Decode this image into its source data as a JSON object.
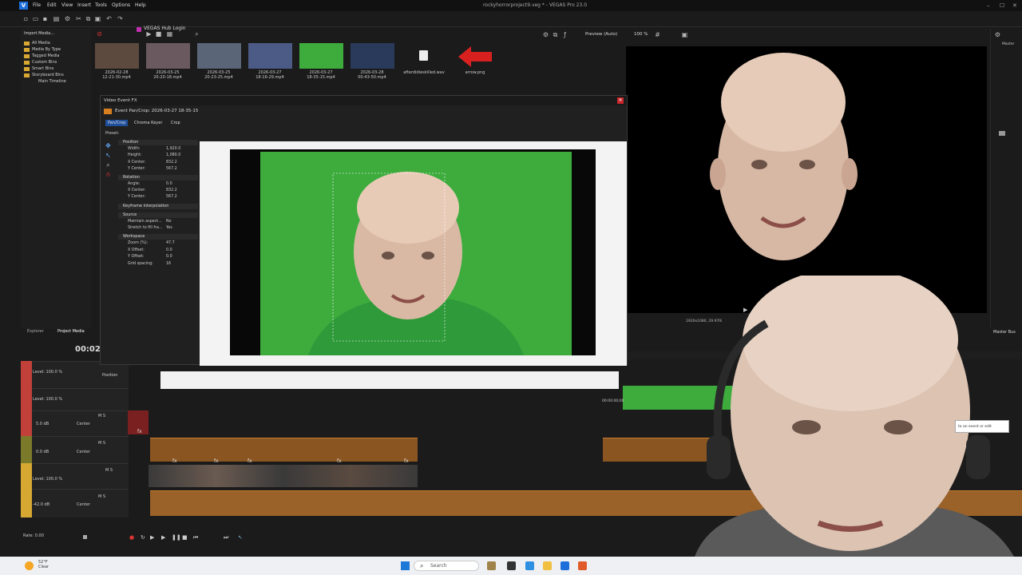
{
  "app": {
    "title": "rockyhorrorproject9.veg * - VEGAS Pro 23.0",
    "menu": [
      "File",
      "Edit",
      "View",
      "Insert",
      "Tools",
      "Options",
      "Help"
    ],
    "hub_login": "VEGAS Hub Login"
  },
  "media_tree": {
    "items": [
      "All Media",
      "Media By Type",
      "Tagged Media",
      "Custom Bins",
      "Smart Bins",
      "Storyboard Bins",
      "Main Timeline"
    ]
  },
  "media_toolbar": {
    "import_label": "Import Media..."
  },
  "media_thumbnails": [
    {
      "caption": "2026-02-28\n12-21-30.mp4",
      "icon": "video-thumbnail"
    },
    {
      "caption": "2026-03-25\n20-20-18.mp4",
      "icon": "video-thumbnail"
    },
    {
      "caption": "2026-03-25\n20-23-25.mp4",
      "icon": "video-thumbnail"
    },
    {
      "caption": "2026-03-27\n18-16-29.mp4",
      "icon": "video-thumbnail"
    },
    {
      "caption": "2026-03-27\n18-35-15.mp4",
      "icon": "video-thumbnail"
    },
    {
      "caption": "2026-03-28\n00-43-50.mp4",
      "icon": "video-thumbnail"
    },
    {
      "caption": "afterdidieskilled.wav",
      "icon": "audio-file-icon"
    },
    {
      "caption": "arrow.png",
      "icon": "red-arrow-image"
    }
  ],
  "video_fx": {
    "window_title": "Video Event FX",
    "chain_label": "Event Pan/Crop: 2026-03-27 18-35-15",
    "tabs": [
      "Pan/Crop",
      "Chroma Keyer",
      "Crop"
    ],
    "preset_label": "Preset:",
    "sections": [
      {
        "title": "Position",
        "props": [
          [
            "Width:",
            "1,920.0"
          ],
          [
            "Height:",
            "1,080.0"
          ],
          [
            "X Center:",
            "832.2"
          ],
          [
            "Y Center:",
            "567.2"
          ]
        ]
      },
      {
        "title": "Rotation",
        "props": [
          [
            "Angle:",
            "0.0"
          ],
          [
            "X Center:",
            "832.2"
          ],
          [
            "Y Center:",
            "567.2"
          ]
        ]
      },
      {
        "title": "Keyframe interpolation",
        "props": []
      },
      {
        "title": "Source",
        "props": [
          [
            "Maintain aspect...",
            "No"
          ],
          [
            "Stretch to fill fra...",
            "Yes"
          ]
        ]
      },
      {
        "title": "Workspace",
        "props": [
          [
            "Zoom (%):",
            "47.7"
          ],
          [
            "X Offset:",
            "0.0"
          ],
          [
            "Y Offset:",
            "0.0"
          ],
          [
            "Grid spacing:",
            "16"
          ]
        ]
      }
    ],
    "timeline_label": "Position",
    "timeline_timecode": "00:00:00;00"
  },
  "preview": {
    "mode": "Preview (Auto)",
    "zoom": "100 %",
    "resolution_info": "1920x1080, 29.970i"
  },
  "master_bus": {
    "label": "Master",
    "bus_label": "Master Bus"
  },
  "timeline": {
    "tabs": [
      "Explorer",
      "Project Media"
    ],
    "timecode": "00:02:",
    "tracks": [
      {
        "label": "Level: 100.0 %",
        "kind": "video",
        "color": "#c2403a"
      },
      {
        "label": "Level: 100.0 %",
        "kind": "video",
        "color": "#c2403a"
      },
      {
        "label": "5.0 dB",
        "pan": "Center",
        "kind": "audio",
        "color": "#c2403a"
      },
      {
        "label": "0.0 dB",
        "pan": "Center",
        "kind": "audio",
        "color": "#7a7a2a"
      },
      {
        "label": "Level: 100.0 %",
        "kind": "video",
        "color": "#d6a832"
      },
      {
        "label": "-42.0 dB",
        "pan": "Center",
        "kind": "audio",
        "color": "#d6a832"
      }
    ],
    "rate_label": "Rate: 0.00",
    "fx_marker": "fx",
    "ms_label": "M S"
  },
  "tooltip": {
    "text": "to an event or edit"
  },
  "taskbar": {
    "weather_temp": "52°F",
    "weather_desc": "Clear",
    "search_placeholder": "Search"
  },
  "colors": {
    "accent": "#1f4f9c",
    "green_screen": "#3dac3d",
    "audio_clip": "#8a5520"
  }
}
